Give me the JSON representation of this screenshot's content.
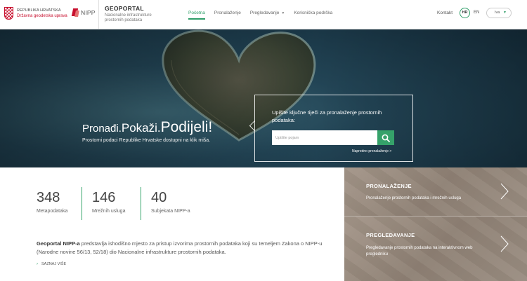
{
  "header": {
    "gov_line1": "REPUBLIKA HRVATSKA",
    "gov_line2": "Državna geodetska uprava",
    "nipp_logo": "NIPP",
    "portal_title": "GEOPORTAL",
    "portal_subtitle_1": "Nacionalne infrastrukture",
    "portal_subtitle_2": "prostornih podataka",
    "nav": [
      {
        "label": "Početna",
        "active": true
      },
      {
        "label": "Pronalaženje",
        "active": false
      },
      {
        "label": "Pregledavanje",
        "active": false,
        "dropdown": true
      },
      {
        "label": "Korisnička podrška",
        "active": false
      }
    ],
    "contact": "Kontakt",
    "lang_hr": "HR",
    "lang_en": "EN",
    "user": "Iva"
  },
  "hero": {
    "title_part1": "Pronađi.",
    "title_part2": "Pokaži.",
    "title_part3": "Podijeli!",
    "subtitle": "Prostorni podaci Republike Hrvatske dostupni na klik miša.",
    "search_prompt": "Upišite ključne riječi za pronalaženje prostornih podataka:",
    "search_placeholder": "Upišite pojam",
    "advanced_search": "Napredno pronalaženje >"
  },
  "stats": [
    {
      "value": "348",
      "label": "Metapodataka"
    },
    {
      "value": "146",
      "label": "Mrežnih usluga"
    },
    {
      "value": "40",
      "label": "Subjekata NIPP-a"
    }
  ],
  "about": {
    "bold": "Geoportal NIPP-a",
    "text": " predstavlja ishodišno mjesto za pristup izvorima prostornih podataka koji su temeljem Zakona o NIPP-u (Narodne novine 56/13, 52/18) dio Nacionalne infrastrukture prostornih podataka.",
    "more": "SAZNAJ VIŠE"
  },
  "panels": [
    {
      "title": "PRONALAŽENJE",
      "desc": "Pronalaženje prostornih podataka i mrežnih usluga"
    },
    {
      "title": "PREGLEDAVANJE",
      "desc": "Pregledavanje prostornih podataka na interaktivnom web pregledniku"
    }
  ],
  "colors": {
    "accent": "#2e9e68",
    "brand_red": "#c8102e",
    "search_button": "#35a26a"
  }
}
